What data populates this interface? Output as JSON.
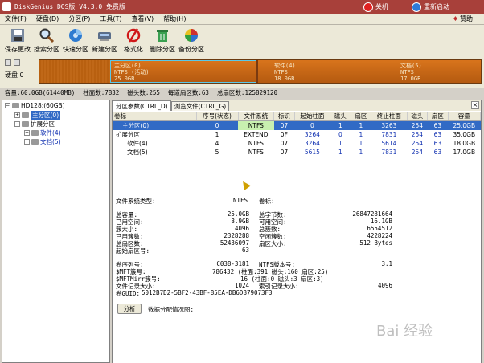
{
  "window": {
    "title": "DiskGenius DOS版 V4.3.0 免费版",
    "shutdown": "关机",
    "reboot": "重新启动"
  },
  "menu": [
    "文件(F)",
    "硬盘(D)",
    "分区(P)",
    "工具(T)",
    "查看(V)",
    "帮助(H)"
  ],
  "donate": "赞助",
  "toolbar": [
    "保存更改",
    "搜索分区",
    "快速分区",
    "新建分区",
    "格式化",
    "删除分区",
    "备份分区"
  ],
  "diskmap": {
    "disk_label": "硬盘 0",
    "main": {
      "line1": "主分区(0)",
      "line2": "NTFS (活动)",
      "line3": "25.0GB"
    },
    "soft": {
      "line1": "软件(4)",
      "line2": "NTFS",
      "line3": "18.0GB"
    },
    "doc": {
      "line1": "文档(5)",
      "line2": "NTFS",
      "line3": "17.0GB"
    }
  },
  "infoline": [
    "容量:60.0GB(61440MB)",
    "柱面数:7832",
    "磁头数:255",
    "每道扇区数:63",
    "总扇区数:125829120"
  ],
  "tree": {
    "disk": "HD128:(60GB)",
    "main": "主分区(0)",
    "ext": "扩展分区",
    "soft": "软件(4)",
    "doc": "文档(5)"
  },
  "tabs": [
    "分区参数(CTRL_D)",
    "浏览文件(CTRL_G)"
  ],
  "table": {
    "headers": [
      "卷标",
      "序号(状态)",
      "文件系统",
      "标识",
      "起始柱面",
      "磁头",
      "扇区",
      "终止柱面",
      "磁头",
      "扇区",
      "容量"
    ],
    "rows": [
      [
        "主分区(0)",
        "0",
        "NTFS",
        "07",
        "0",
        "1",
        "1",
        "3263",
        "254",
        "63",
        "25.0GB"
      ],
      [
        "扩展分区",
        "1",
        "EXTEND",
        "0F",
        "3264",
        "0",
        "1",
        "7831",
        "254",
        "63",
        "35.0GB"
      ],
      [
        "软件(4)",
        "4",
        "NTFS",
        "07",
        "3264",
        "1",
        "1",
        "5614",
        "254",
        "63",
        "18.0GB"
      ],
      [
        "文档(5)",
        "5",
        "NTFS",
        "07",
        "5615",
        "1",
        "1",
        "7831",
        "254",
        "63",
        "17.0GB"
      ]
    ]
  },
  "details": {
    "fs_type_label": "文件系统类型:",
    "fs_type": "NTFS",
    "vol_label": "卷标:",
    "left": [
      [
        "总容量:",
        "25.0GB"
      ],
      [
        "已用空间:",
        "8.9GB"
      ],
      [
        "簇大小:",
        "4096"
      ],
      [
        "已用簇数:",
        "2328288"
      ],
      [
        "总扇区数:",
        "52436097"
      ],
      [
        "起始扇区号:",
        "63"
      ]
    ],
    "right": [
      [
        "总字节数:",
        "26847281664"
      ],
      [
        "可用空间:",
        "16.1GB"
      ],
      [
        "总簇数:",
        "6554512"
      ],
      [
        "空闲簇数:",
        "4228224"
      ],
      [
        "扇区大小:",
        "512 Bytes"
      ]
    ],
    "serial_label": "卷序列号:",
    "serial": "C038-3181",
    "ntfs_ver_label": "NTFS版本号:",
    "ntfs_ver": "3.1",
    "mft_label": "$MFT簇号:",
    "mft": "786432 (柱面:391 磁头:160 扇区:25)",
    "mftmirr_label": "$MFTMirr簇号:",
    "mftmirr": "16 (柱面:0 磁头:3 扇区:3)",
    "rec_label": "文件记录大小:",
    "rec": "1024",
    "idx_label": "索引记录大小:",
    "idx": "4096",
    "guid_label": "卷GUID:",
    "guid": "5012B7D2-5BF2-43BF-85EA-DB6DB79073F3",
    "analyze": "分析",
    "chart_label": "数据分配情况图:"
  },
  "watermark": "Bai 经验"
}
